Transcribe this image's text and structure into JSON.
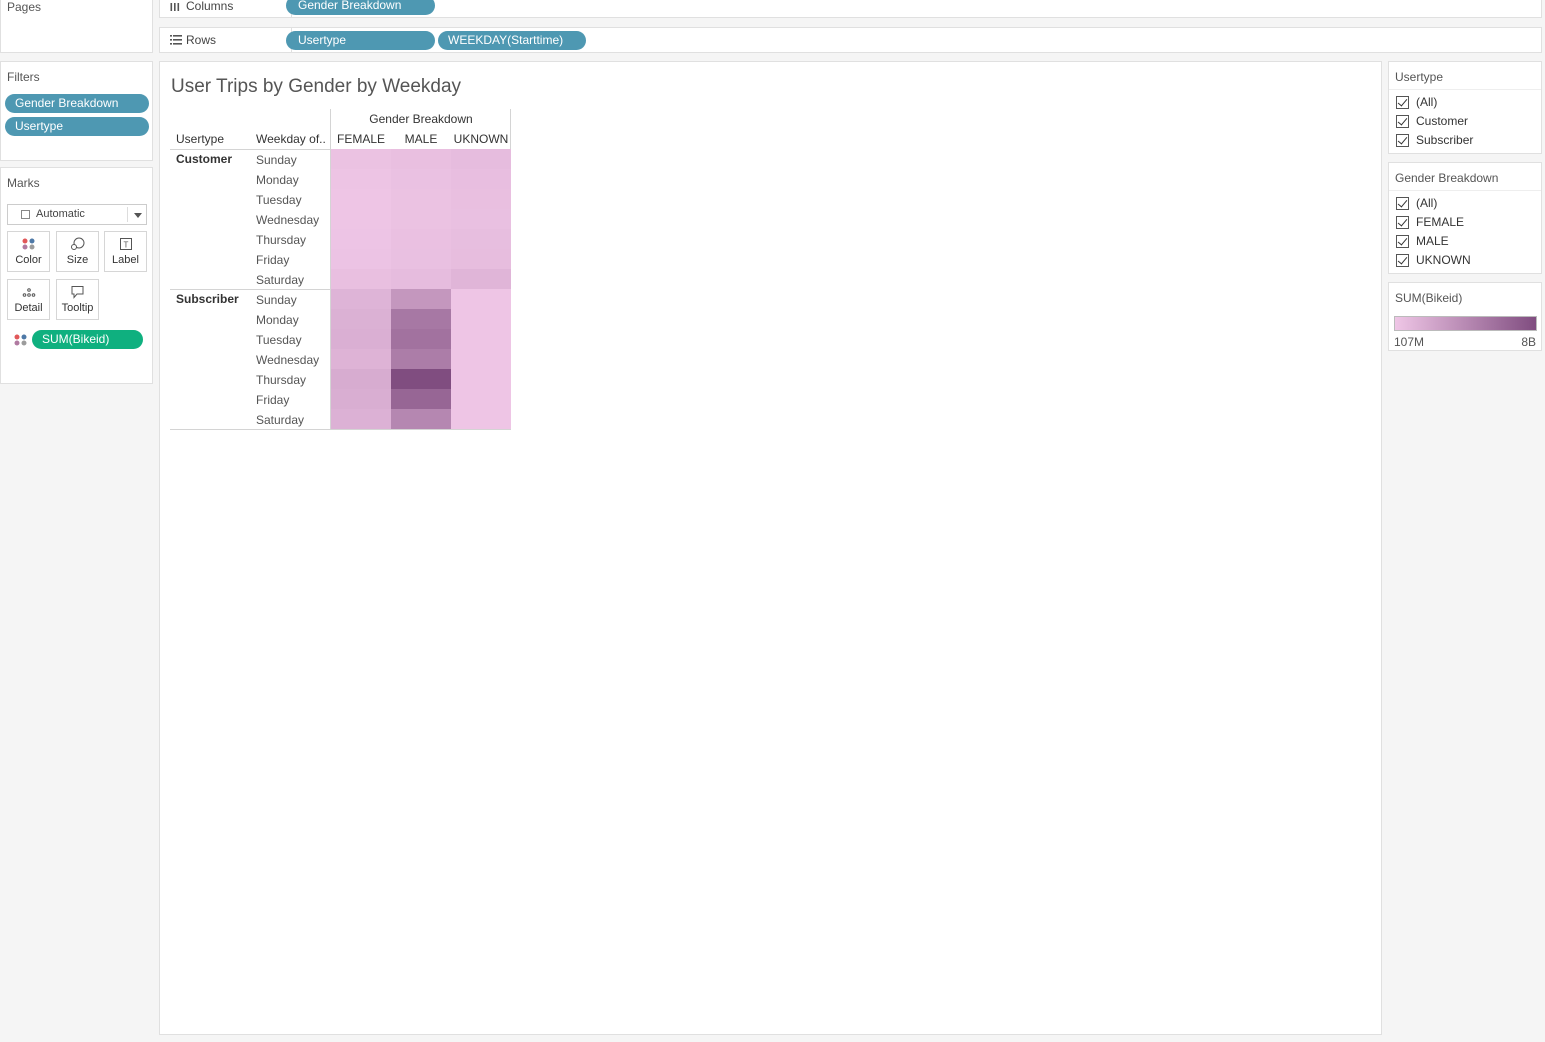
{
  "pages": {
    "title": "Pages"
  },
  "filters": {
    "title": "Filters",
    "pills": [
      "Gender Breakdown",
      "Usertype"
    ]
  },
  "marks": {
    "title": "Marks",
    "mark_type": "Automatic",
    "buttons": [
      "Color",
      "Size",
      "Label",
      "Detail",
      "Tooltip"
    ],
    "field_pill": "SUM(Bikeid)",
    "color_pill_color": "#0fb07f"
  },
  "shelves": {
    "columns_label": "Columns",
    "columns_pills": [
      "Gender Breakdown"
    ],
    "rows_label": "Rows",
    "rows_pills": [
      "Usertype",
      "WEEKDAY(Starttime)"
    ],
    "pill_color": "#4e98b2"
  },
  "view": {
    "title": "User Trips by Gender by Weekday",
    "col_group_header": "Gender Breakdown",
    "row_header_1": "Usertype",
    "row_header_2": "Weekday of..",
    "columns": [
      "FEMALE",
      "MALE",
      "UKNOWN"
    ],
    "groups": [
      {
        "name": "Customer",
        "days": [
          "Sunday",
          "Monday",
          "Tuesday",
          "Wednesday",
          "Thursday",
          "Friday",
          "Saturday"
        ]
      },
      {
        "name": "Subscriber",
        "days": [
          "Sunday",
          "Monday",
          "Tuesday",
          "Wednesday",
          "Thursday",
          "Friday",
          "Saturday"
        ]
      }
    ]
  },
  "chart_data": {
    "type": "heatmap",
    "title": "User Trips by Gender by Weekday",
    "measure": "SUM(Bikeid)",
    "x_categories": [
      "FEMALE",
      "MALE",
      "UKNOWN"
    ],
    "y_categories": [
      "Customer Sunday",
      "Customer Monday",
      "Customer Tuesday",
      "Customer Wednesday",
      "Customer Thursday",
      "Customer Friday",
      "Customer Saturday",
      "Subscriber Sunday",
      "Subscriber Monday",
      "Subscriber Tuesday",
      "Subscriber Wednesday",
      "Subscriber Thursday",
      "Subscriber Friday",
      "Subscriber Saturday"
    ],
    "values": [
      [
        0.4,
        0.55,
        0.75
      ],
      [
        0.25,
        0.45,
        0.6
      ],
      [
        0.18,
        0.4,
        0.55
      ],
      [
        0.15,
        0.38,
        0.5
      ],
      [
        0.22,
        0.48,
        0.65
      ],
      [
        0.3,
        0.5,
        0.7
      ],
      [
        0.55,
        0.75,
        1.2
      ],
      [
        1.3,
        3.2,
        0.15
      ],
      [
        1.5,
        5.2,
        0.15
      ],
      [
        1.6,
        5.6,
        0.15
      ],
      [
        1.35,
        4.9,
        0.15
      ],
      [
        1.8,
        8.0,
        0.15
      ],
      [
        1.65,
        6.4,
        0.15
      ],
      [
        1.45,
        4.2,
        0.15
      ]
    ],
    "value_unit": "billions",
    "color_range": [
      "#efc6e6",
      "#804d80"
    ],
    "legend_min_label": "107M",
    "legend_max_label": "8B",
    "legend_min": 0.107,
    "legend_max": 8.0
  },
  "usertype_filter": {
    "title": "Usertype",
    "options": [
      "(All)",
      "Customer",
      "Subscriber"
    ]
  },
  "gender_filter": {
    "title": "Gender Breakdown",
    "options": [
      "(All)",
      "FEMALE",
      "MALE",
      "UKNOWN"
    ]
  },
  "legend": {
    "title": "SUM(Bikeid)",
    "min_label": "107M",
    "max_label": "8B"
  }
}
